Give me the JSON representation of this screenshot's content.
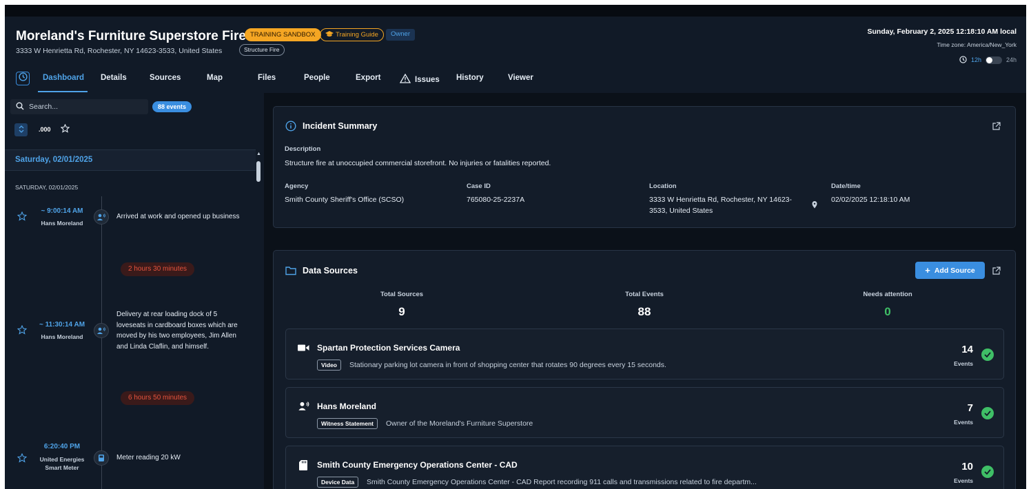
{
  "header": {
    "title": "Moreland's Furniture Superstore Fire",
    "badge_sandbox": "TRAINING SANDBOX",
    "badge_guide": "Training Guide",
    "badge_owner": "Owner",
    "address": "3333 W Henrietta Rd, Rochester, NY 14623-3533, United States",
    "incident_type": "Structure Fire",
    "datetime": "Sunday, February 2, 2025 12:18:10 AM local",
    "timezone": "Time zone: America/New_York",
    "clock_12h": "12h",
    "clock_24h": "24h"
  },
  "tabs": [
    "Dashboard",
    "Details",
    "Sources",
    "Map",
    "Files",
    "People",
    "Export",
    "Issues",
    "History",
    "Viewer"
  ],
  "active_tab": "Dashboard",
  "sidebar": {
    "search_placeholder": "Search...",
    "events_count": "88 events",
    "time_format": ".000",
    "day_header": "Saturday, 02/01/2025",
    "day_subheader": "SATURDAY, 02/01/2025",
    "events": [
      {
        "time": "~ 9:00:14 AM",
        "who": "Hans Moreland",
        "text": "Arrived at work and opened up business",
        "icon": "speaker-person-icon"
      },
      {
        "time": "~ 11:30:14 AM",
        "who": "Hans Moreland",
        "text": "Delivery at rear loading dock of 5 loveseats in cardboard boxes which are moved by his two employees, Jim Allen and Linda Claflin, and himself.",
        "icon": "speaker-person-icon"
      },
      {
        "time": "6:20:40 PM",
        "who": "United Energies Smart Meter",
        "text": "Meter reading 20 kW",
        "icon": "meter-icon"
      }
    ],
    "gaps": [
      "2 hours 30 minutes",
      "6 hours 50 minutes"
    ]
  },
  "incident_summary": {
    "title": "Incident Summary",
    "description_label": "Description",
    "description": "Structure fire at unoccupied commercial storefront. No injuries or fatalities reported.",
    "agency_label": "Agency",
    "agency": "Smith County Sheriff's Office (SCSO)",
    "case_label": "Case ID",
    "case_id": "765080-25-2237A",
    "location_label": "Location",
    "location": "3333 W Henrietta Rd, Rochester, NY 14623-3533, United States",
    "datetime_label": "Date/time",
    "datetime": "02/02/2025 12:18:10 AM"
  },
  "data_sources": {
    "title": "Data Sources",
    "add_button": "Add Source",
    "stats": [
      {
        "label": "Total Sources",
        "value": "9",
        "color": "#ffffff"
      },
      {
        "label": "Total Events",
        "value": "88",
        "color": "#ffffff"
      },
      {
        "label": "Needs attention",
        "value": "0",
        "color": "#3fbf66"
      }
    ],
    "events_label": "Events",
    "sources": [
      {
        "name": "Spartan Protection Services Camera",
        "tag": "Video",
        "description": "Stationary parking lot camera in front of shopping center that rotates 90 degrees every 15 seconds.",
        "events": "14",
        "icon": "video-camera-icon"
      },
      {
        "name": "Hans Moreland",
        "tag": "Witness Statement",
        "description": "Owner of the Moreland's Furniture Superstore",
        "events": "7",
        "icon": "speaker-person-icon"
      },
      {
        "name": "Smith County Emergency Operations Center - CAD",
        "tag": "Device Data",
        "description": "Smith County Emergency Operations Center - CAD Report recording 911 calls and transmissions related to fire departm...",
        "events": "10",
        "icon": "sd-card-icon"
      }
    ]
  },
  "colors": {
    "accent": "#4fa3e8",
    "sandbox": "#f5a623",
    "success": "#3fbf66",
    "gap": "#e5533d"
  }
}
